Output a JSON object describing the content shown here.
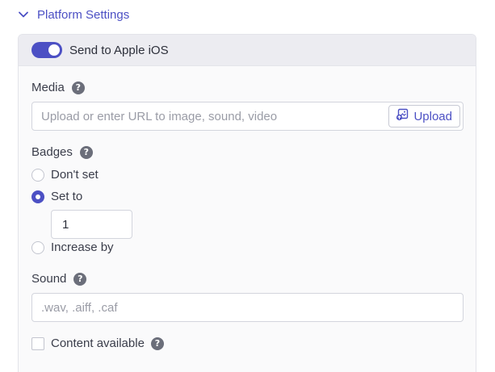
{
  "section": {
    "title": "Platform Settings",
    "expanded": true,
    "icon": "chevron-down-icon"
  },
  "ios": {
    "toggle_label": "Send to Apple iOS",
    "toggle_on": true,
    "media": {
      "label": "Media",
      "placeholder": "Upload or enter URL to image, sound, video",
      "upload_label": "Upload",
      "upload_icon": "image-upload-icon"
    },
    "badges": {
      "label": "Badges",
      "options": [
        "Don't set",
        "Set to",
        "Increase by"
      ],
      "selected": "Set to",
      "value": "1"
    },
    "sound": {
      "label": "Sound",
      "placeholder": ".wav, .aiff, .caf"
    },
    "content_available": {
      "label": "Content available",
      "checked": false
    }
  },
  "colors": {
    "accent": "#4c50c4",
    "header_bg": "#ececf1",
    "card_bg": "#fafafb",
    "border": "#d3d5dd"
  }
}
